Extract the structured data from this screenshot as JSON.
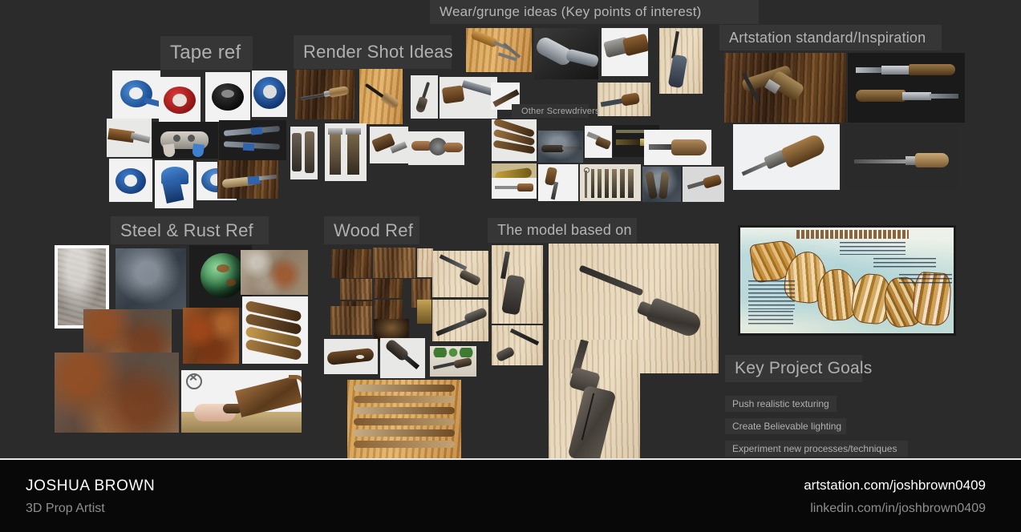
{
  "board": {
    "background_color": "#2b2b2b",
    "sections": [
      {
        "id": "tape-ref",
        "label": "Tape ref"
      },
      {
        "id": "render-shot-ideas",
        "label": "Render Shot Ideas"
      },
      {
        "id": "wear-grunge",
        "label": "Wear/grunge ideas (Key points of interest)"
      },
      {
        "id": "artstation-standard",
        "label": "Artstation standard/Inspiration"
      },
      {
        "id": "other-screwdrivers",
        "label": "Other Screwdrivers"
      },
      {
        "id": "steel-rust-ref",
        "label": "Steel & Rust Ref"
      },
      {
        "id": "wood-ref",
        "label": "Wood Ref"
      },
      {
        "id": "model-based-on",
        "label": "The model based on"
      },
      {
        "id": "key-project-goals",
        "label": "Key Project Goals"
      }
    ],
    "goals": [
      "Push realistic texturing",
      "Create Believable lighting",
      "Experiment new processes/techniques"
    ],
    "grain_diagram": {
      "title": "You'll find six general types of grain",
      "notes": [
        "1. Straight grain means that the fibers in a board run roughly parallel with the vertical axis of the log from which it was sawn.",
        "2. In boards with irregular grain, the wood fibers run at varying and irregular directions from the vertical axis of the log, such as around knots.",
        "3. Diagonal grain results when an otherwise straight-grained log isn't sawn along its vertical axis.",
        "4. A tree that somehow gets twisted produces a log and subsequent boards with spiral grain, where the fibers follow a spiral course with either a left- or right-hand twist.",
        "5. Interlocked grain comes from trees whose fibers in each growth layer tend to align in opposite directions.",
        "6. When the direction of the wood fibers constantly changes, the board has wavy grain."
      ]
    }
  },
  "footer": {
    "name": "JOSHUA BROWN",
    "role": "3D Prop Artist",
    "link_artstation": "artstation.com/joshbrown0409",
    "link_linkedin": "linkedin.com/in/joshbrown0409"
  }
}
